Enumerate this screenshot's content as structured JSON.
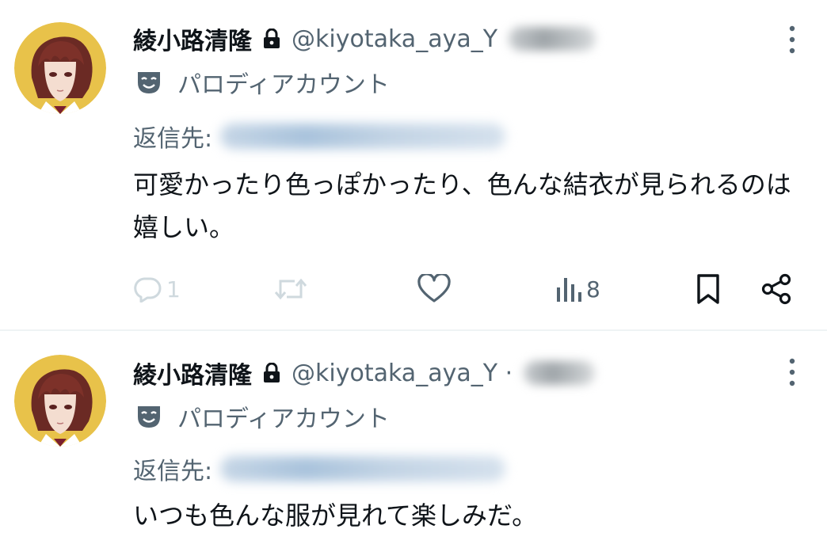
{
  "tweets": [
    {
      "display_name": "綾小路清隆",
      "handle": "@kiyotaka_aya_Y",
      "parody_label": "パロディアカウント",
      "reply_to_label": "返信先:",
      "text": "可愛かったり色っぽかったり、色んな結衣が見られるのは嬉しい。",
      "reply_count": "1",
      "views_count": "8"
    },
    {
      "display_name": "綾小路清隆",
      "handle": "@kiyotaka_aya_Y ·",
      "parody_label": "パロディアカウント",
      "reply_to_label": "返信先:",
      "text": "いつも色んな服が見れて楽しみだ。"
    }
  ],
  "icons": {
    "lock": "lock-icon",
    "more": "more-vertical-icon",
    "parody": "theater-mask-icon",
    "reply": "reply-icon",
    "retweet": "retweet-icon",
    "like": "heart-icon",
    "views": "views-chart-icon",
    "bookmark": "bookmark-icon",
    "share": "share-icon"
  },
  "colors": {
    "text": "#0f1419",
    "secondary": "#536471",
    "faded": "#cfd9de",
    "divider": "#eff3f4",
    "avatar_bg": "#e8c24a"
  }
}
